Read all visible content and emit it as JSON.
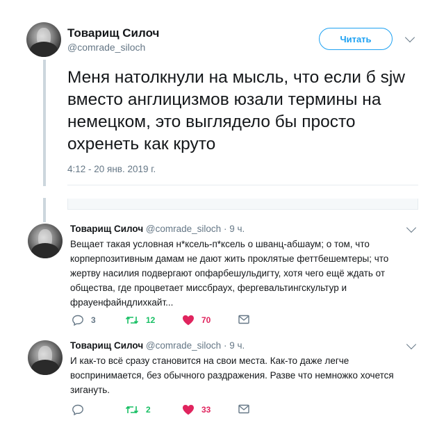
{
  "main_tweet": {
    "author_name": "Товарищ Силоч",
    "author_handle": "@comrade_siloch",
    "follow_label": "Читать",
    "text": "Меня натолкнули на мысль, что если б sjw вместо англицизмов юзали термины на немецком, это выглядело бы просто охренеть как круто",
    "timestamp": "4:12 - 20 янв. 2019 г."
  },
  "replies": [
    {
      "author_name": "Товарищ Силоч",
      "author_handle": "@comrade_siloch",
      "time": "· 9 ч.",
      "text": "Вещает такая условная н*ксель-п*ксель о шванц-абшаум; о том, что корперпозитивным дамам не дают жить проклятые феттбешемтеры; что жертву насилия подвергают опфарбешульдигту, хотя чего ещё ждать от общества, где процветает миссбраух, фергевальтингскультур и фрауенфайндлихкайт...",
      "replies_count": "3",
      "retweets_count": "12",
      "likes_count": "70"
    },
    {
      "author_name": "Товарищ Силоч",
      "author_handle": "@comrade_siloch",
      "time": "· 9 ч.",
      "text": "И как-то всё сразу становится на свои места. Как-то даже легче воспринимается, без обычного раздражения. Разве что немножко хочется зигануть.",
      "replies_count": "",
      "retweets_count": "2",
      "likes_count": "33"
    }
  ],
  "colors": {
    "accent": "#1da1f2",
    "retweet": "#17bf63",
    "like": "#e0245e",
    "secondary_text": "#657786",
    "thread_line": "#ccd6dd"
  },
  "icons": [
    "avatar",
    "chevron-down-icon",
    "reply-icon",
    "retweet-icon",
    "heart-icon",
    "envelope-icon"
  ]
}
